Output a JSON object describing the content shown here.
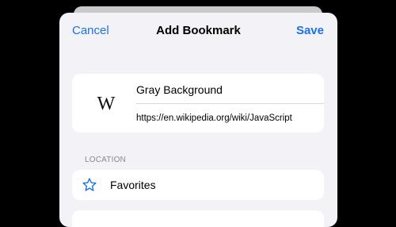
{
  "nav": {
    "cancel_label": "Cancel",
    "title": "Add Bookmark",
    "save_label": "Save"
  },
  "bookmark": {
    "favicon_text": "W",
    "title_value": "Gray Background",
    "url_value": "https://en.wikipedia.org/wiki/JavaScript"
  },
  "location": {
    "section_header": "LOCATION",
    "folder_label": "Favorites",
    "icon": "star-icon"
  },
  "colors": {
    "accent": "#1a73e8",
    "sheet_background": "#f2f2f7",
    "card_background": "#ffffff",
    "backdrop": "#000000"
  }
}
